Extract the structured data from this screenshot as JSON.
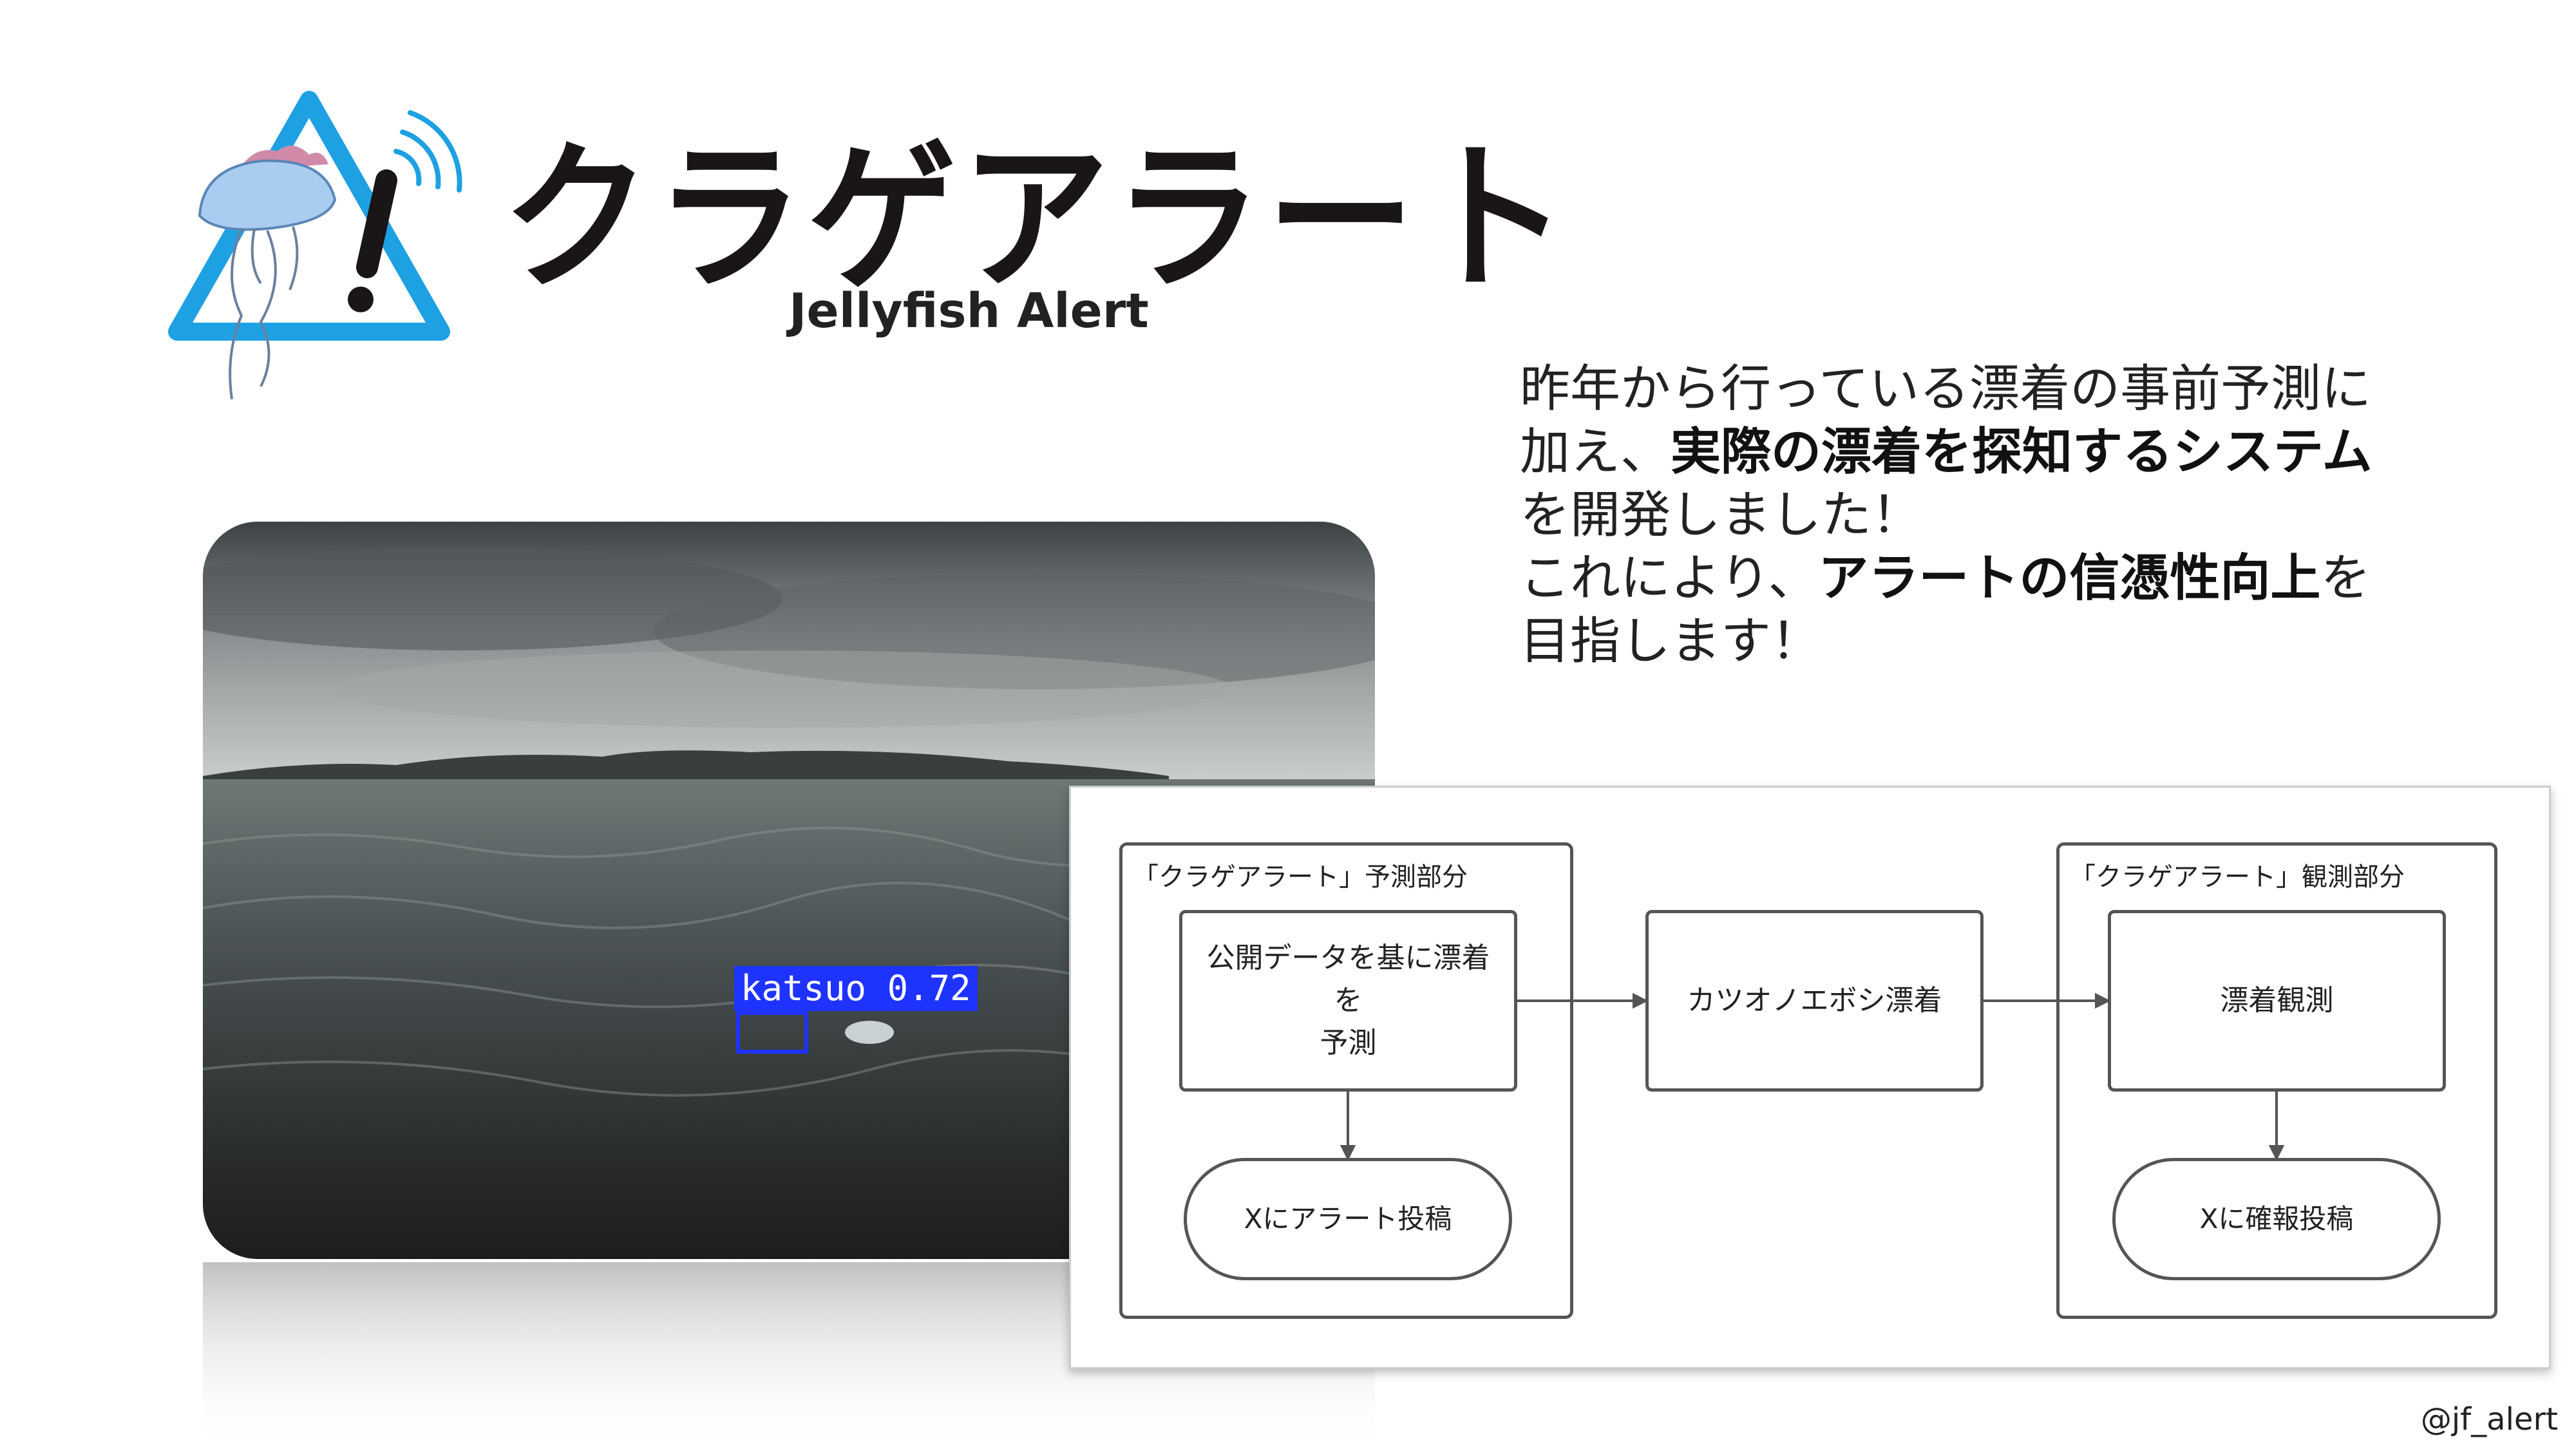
{
  "logo": {
    "title": "クラゲアラート",
    "subtitle": "Jellyfish Alert",
    "icon": "jellyfish-warning-icon",
    "colors": {
      "triangle": "#1ea1e3",
      "jelly_body": "#a9cdf0",
      "jelly_crest": "#d08aa8",
      "title": "#1a1516"
    }
  },
  "description": {
    "line1": "昨年から行っている漂着の事前予測に",
    "line2_pre": "加え、",
    "line2_bold": "実際の漂着を探知するシステム",
    "line3": "を開発しました！",
    "line4_pre": "これにより、",
    "line4_bold": "アラートの信憑性向上",
    "line4_post": "を",
    "line5": "目指します！"
  },
  "photo": {
    "detection_label": "katsuo 0.72",
    "detection_color": "#1f33ff"
  },
  "flowchart": {
    "predict_group_title": "「クラゲアラート」予測部分",
    "observe_group_title": "「クラゲアラート」観測部分",
    "predict_node": "公開データを基に漂着を予測",
    "post_alert_node": "Xにアラート投稿",
    "stranding_node": "カツオノエボシ漂着",
    "observe_node": "漂着観測",
    "post_confirm_node": "Xに確報投稿"
  },
  "footer": {
    "handle": "@jf_alert"
  }
}
